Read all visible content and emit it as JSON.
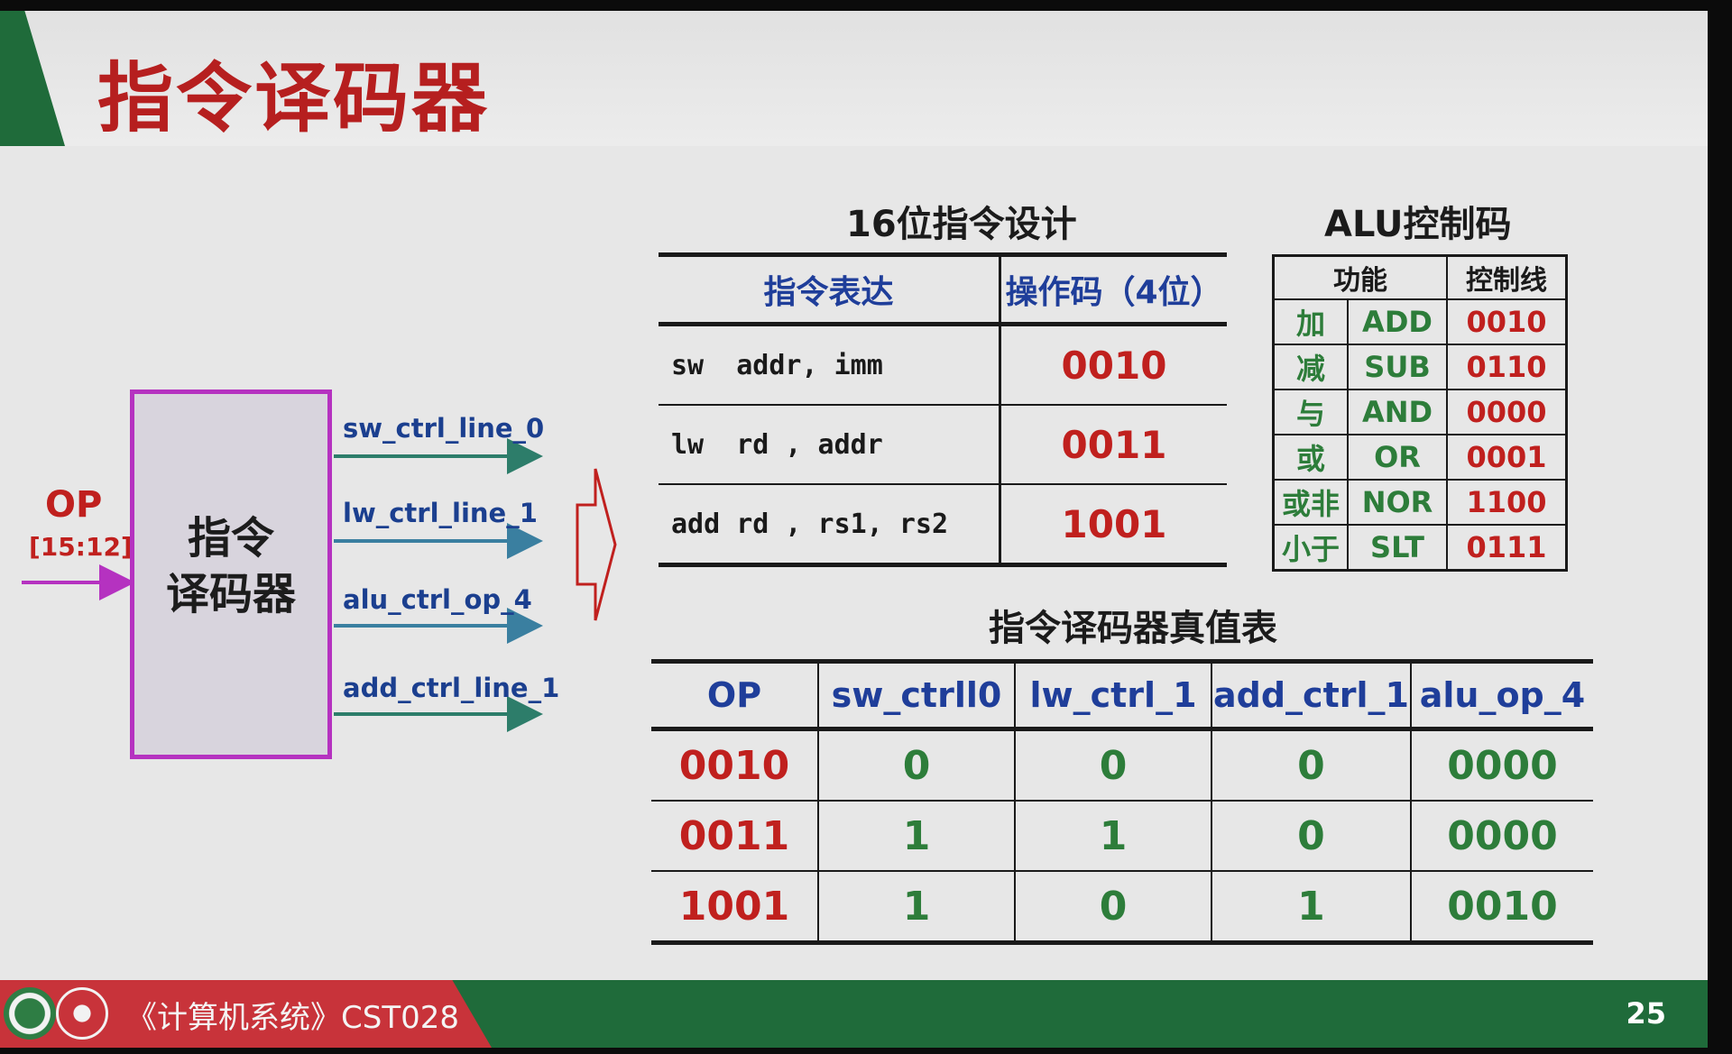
{
  "title": "指令译码器",
  "decoder": {
    "line1": "指令",
    "line2": "译码器",
    "input_label": "OP",
    "input_range": "[15:12]",
    "outputs": [
      "sw_ctrl_line_0",
      "lw_ctrl_line_1",
      "alu_ctrl_op_4",
      "add_ctrl_line_1"
    ]
  },
  "instr_table": {
    "title": "16位指令设计",
    "headers": [
      "指令表达",
      "操作码（4位）"
    ],
    "rows": [
      {
        "expr": "sw  addr, imm",
        "opcode": "0010"
      },
      {
        "expr": "lw  rd , addr",
        "opcode": "0011"
      },
      {
        "expr": "add rd , rs1, rs2",
        "opcode": "1001"
      }
    ]
  },
  "alu_table": {
    "title": "ALU控制码",
    "headers": [
      "功能",
      "控制线"
    ],
    "rows": [
      {
        "cn": "加",
        "en": "ADD",
        "code": "0010"
      },
      {
        "cn": "减",
        "en": "SUB",
        "code": "0110"
      },
      {
        "cn": "与",
        "en": "AND",
        "code": "0000"
      },
      {
        "cn": "或",
        "en": "OR",
        "code": "0001"
      },
      {
        "cn": "或非",
        "en": "NOR",
        "code": "1100"
      },
      {
        "cn": "小于",
        "en": "SLT",
        "code": "0111"
      }
    ]
  },
  "truth_table": {
    "title": "指令译码器真值表",
    "headers": [
      "OP",
      "sw_ctrll0",
      "lw_ctrl_1",
      "add_ctrl_1",
      "alu_op_4"
    ],
    "rows": [
      [
        "0010",
        "0",
        "0",
        "0",
        "0000"
      ],
      [
        "0011",
        "1",
        "1",
        "0",
        "0000"
      ],
      [
        "1001",
        "1",
        "0",
        "1",
        "0010"
      ]
    ]
  },
  "footer": {
    "course": "《计算机系统》CST028",
    "page": "25"
  },
  "colors": {
    "title_red": "#b61f1f",
    "accent_green": "#1f6b3a",
    "footer_red": "#c8333a",
    "decoder_border": "#b532c0",
    "header_blue": "#1f3e9a",
    "value_green": "#2d7d3a"
  }
}
